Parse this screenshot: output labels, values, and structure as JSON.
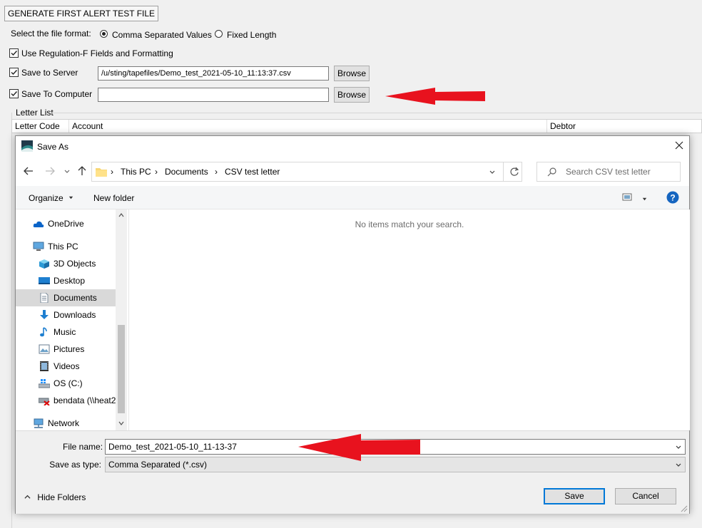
{
  "form": {
    "title": "GENERATE FIRST ALERT TEST FILE",
    "format_label": "Select the file format:",
    "format_options": [
      "Comma Separated Values",
      "Fixed Length"
    ],
    "selected_format": "Comma Separated Values",
    "regulation_label": "Use Regulation-F Fields and Formatting",
    "save_server_label": "Save to Server",
    "server_path": "/u/sting/tapefiles/Demo_test_2021-05-10_11:13:37.csv",
    "save_computer_label": "Save To Computer",
    "computer_path": "",
    "browse_label": "Browse",
    "letter_list_label": "Letter List",
    "columns": [
      "Letter Code",
      "Account",
      "Debtor"
    ]
  },
  "dialog": {
    "title": "Save As",
    "breadcrumb": [
      "This PC",
      "Documents",
      "CSV test letter"
    ],
    "search_placeholder": "Search CSV test letter",
    "organize_label": "Organize",
    "new_folder_label": "New folder",
    "empty_message": "No items match your search.",
    "tree": [
      {
        "label": "OneDrive",
        "icon": "onedrive-icon",
        "indent": 0
      },
      {
        "label": "This PC",
        "icon": "computer-icon",
        "indent": 0
      },
      {
        "label": "3D Objects",
        "icon": "cube-icon",
        "indent": 1
      },
      {
        "label": "Desktop",
        "icon": "desktop-icon",
        "indent": 1
      },
      {
        "label": "Documents",
        "icon": "document-icon",
        "indent": 1,
        "selected": true
      },
      {
        "label": "Downloads",
        "icon": "download-icon",
        "indent": 1
      },
      {
        "label": "Music",
        "icon": "music-icon",
        "indent": 1
      },
      {
        "label": "Pictures",
        "icon": "pictures-icon",
        "indent": 1
      },
      {
        "label": "Videos",
        "icon": "video-icon",
        "indent": 1
      },
      {
        "label": "OS (C:)",
        "icon": "drive-icon",
        "indent": 1
      },
      {
        "label": "bendata (\\\\heat2",
        "icon": "network-drive-icon",
        "indent": 1
      },
      {
        "label": "Network",
        "icon": "network-icon",
        "indent": 0
      }
    ],
    "file_name_label": "File name:",
    "file_name": "Demo_test_2021-05-10_11-13-37",
    "save_type_label": "Save as type:",
    "save_type": "Comma Separated (*.csv)",
    "hide_folders_label": "Hide Folders",
    "save_label": "Save",
    "cancel_label": "Cancel"
  },
  "colors": {
    "annotation_arrow": "#e8121e",
    "accent": "#0078d7",
    "help": "#1565c0"
  }
}
